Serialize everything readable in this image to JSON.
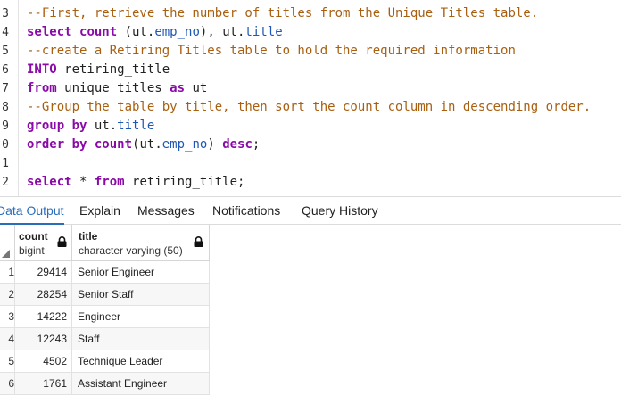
{
  "editor": {
    "lines": [
      {
        "ln": "3",
        "tokens": [
          {
            "t": "--First, retrieve the number of titles from the Unique Titles table.",
            "c": "comment"
          }
        ]
      },
      {
        "ln": "4",
        "tokens": [
          {
            "t": "select",
            "c": "kw"
          },
          {
            "t": " ",
            "c": "plain"
          },
          {
            "t": "count",
            "c": "kw"
          },
          {
            "t": " (ut.",
            "c": "plain"
          },
          {
            "t": "emp_no",
            "c": "prop"
          },
          {
            "t": "), ut.",
            "c": "plain"
          },
          {
            "t": "title",
            "c": "prop"
          }
        ]
      },
      {
        "ln": "5",
        "tokens": [
          {
            "t": "--create a Retiring Titles table to hold the required information",
            "c": "comment"
          }
        ]
      },
      {
        "ln": "6",
        "tokens": [
          {
            "t": "INTO",
            "c": "kw"
          },
          {
            "t": " retiring_title",
            "c": "plain"
          }
        ]
      },
      {
        "ln": "7",
        "tokens": [
          {
            "t": "from",
            "c": "kw"
          },
          {
            "t": " unique_titles ",
            "c": "plain"
          },
          {
            "t": "as",
            "c": "kw"
          },
          {
            "t": " ut",
            "c": "plain"
          }
        ]
      },
      {
        "ln": "8",
        "tokens": [
          {
            "t": "--Group the table by title, then sort the count column in descending order.",
            "c": "comment"
          }
        ]
      },
      {
        "ln": "9",
        "tokens": [
          {
            "t": "group by",
            "c": "kw"
          },
          {
            "t": " ut.",
            "c": "plain"
          },
          {
            "t": "title",
            "c": "prop"
          }
        ]
      },
      {
        "ln": "0",
        "tokens": [
          {
            "t": "order by",
            "c": "kw"
          },
          {
            "t": " ",
            "c": "plain"
          },
          {
            "t": "count",
            "c": "kw"
          },
          {
            "t": "(ut.",
            "c": "plain"
          },
          {
            "t": "emp_no",
            "c": "prop"
          },
          {
            "t": ") ",
            "c": "plain"
          },
          {
            "t": "desc",
            "c": "kw"
          },
          {
            "t": ";",
            "c": "plain"
          }
        ]
      },
      {
        "ln": "1",
        "tokens": []
      },
      {
        "ln": "2",
        "tokens": [
          {
            "t": "select",
            "c": "kw"
          },
          {
            "t": " * ",
            "c": "plain"
          },
          {
            "t": "from",
            "c": "kw"
          },
          {
            "t": " retiring_title;",
            "c": "plain"
          }
        ]
      }
    ]
  },
  "tabs": {
    "data_output": "Data Output",
    "explain": "Explain",
    "messages": "Messages",
    "notifications": "Notifications",
    "query_history": "Query History"
  },
  "grid": {
    "columns": [
      {
        "name": "count",
        "type": "bigint"
      },
      {
        "name": "title",
        "type": "character varying (50)"
      }
    ],
    "rows": [
      {
        "idx": "1",
        "count": "29414",
        "title": "Senior Engineer"
      },
      {
        "idx": "2",
        "count": "28254",
        "title": "Senior Staff"
      },
      {
        "idx": "3",
        "count": "14222",
        "title": "Engineer"
      },
      {
        "idx": "4",
        "count": "12243",
        "title": "Staff"
      },
      {
        "idx": "5",
        "count": "4502",
        "title": "Technique Leader"
      },
      {
        "idx": "6",
        "count": "1761",
        "title": "Assistant Engineer"
      }
    ]
  },
  "colors": {
    "comment": "#a85f10",
    "keyword": "#8a0aa8",
    "property": "#1f57b5",
    "active_tab": "#2a6ebb"
  }
}
